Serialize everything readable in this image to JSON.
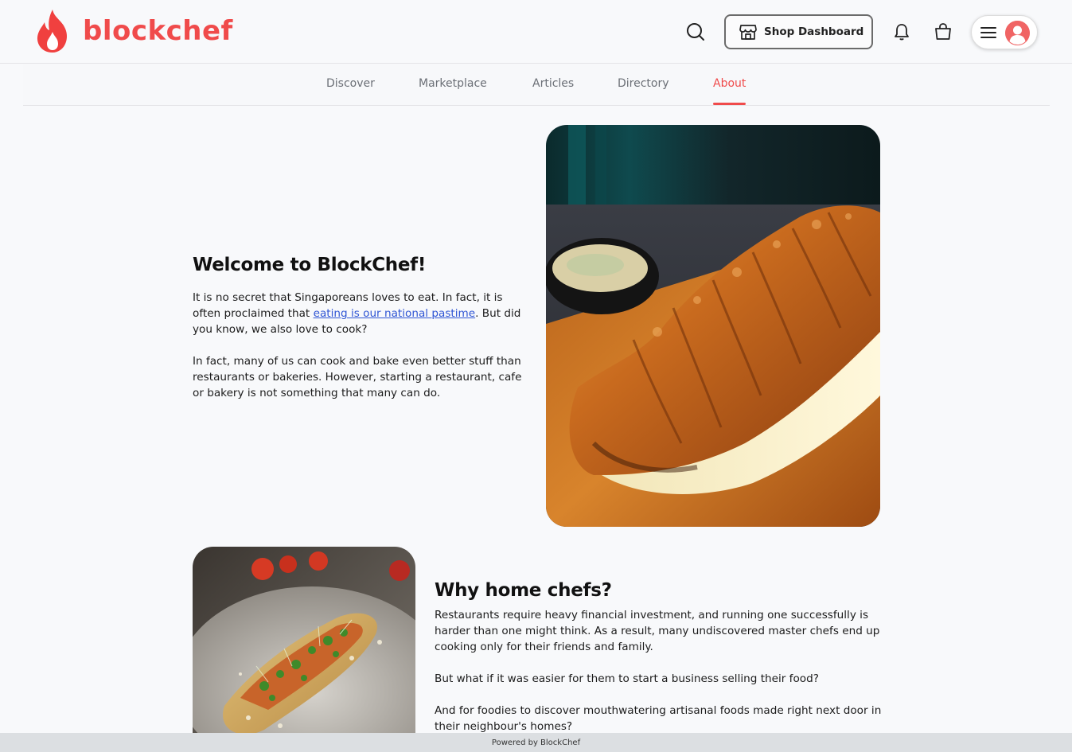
{
  "brand": {
    "name": "blockchef",
    "color": "#f04b4b"
  },
  "header": {
    "shop_dashboard_label": "Shop Dashboard",
    "icons": [
      "search-icon",
      "store-icon",
      "bell-icon",
      "shopping-bag-icon",
      "hamburger-menu-icon",
      "user-avatar-icon"
    ]
  },
  "nav": {
    "items": [
      {
        "label": "Discover"
      },
      {
        "label": "Marketplace"
      },
      {
        "label": "Articles"
      },
      {
        "label": "Directory"
      },
      {
        "label": "About"
      }
    ],
    "active": "About"
  },
  "welcome": {
    "title": "Welcome to BlockChef!",
    "p1_before": "It is no secret that Singaporeans loves to eat. In fact, it is often proclaimed that ",
    "p1_link": "eating is our national pastime",
    "p1_after": ". But did you know, we also love to cook?",
    "p2": "In fact, many of us can cook and bake even better stuff than restaurants or bakeries. However, starting a restaurant, cafe or bakery is not something that many can do."
  },
  "why": {
    "title": "Why home chefs?",
    "p1": "Restaurants require heavy financial investment, and running one successfully is harder than one might think. As a result, many undiscovered master chefs end up cooking only for their friends and family.",
    "p2": "But what if it was easier for them to start a business selling their food?",
    "p3": "And for foodies to discover mouthwatering artisanal foods made right next door in their neighbour's homes?"
  },
  "footer": {
    "text": "Powered by BlockChef"
  }
}
